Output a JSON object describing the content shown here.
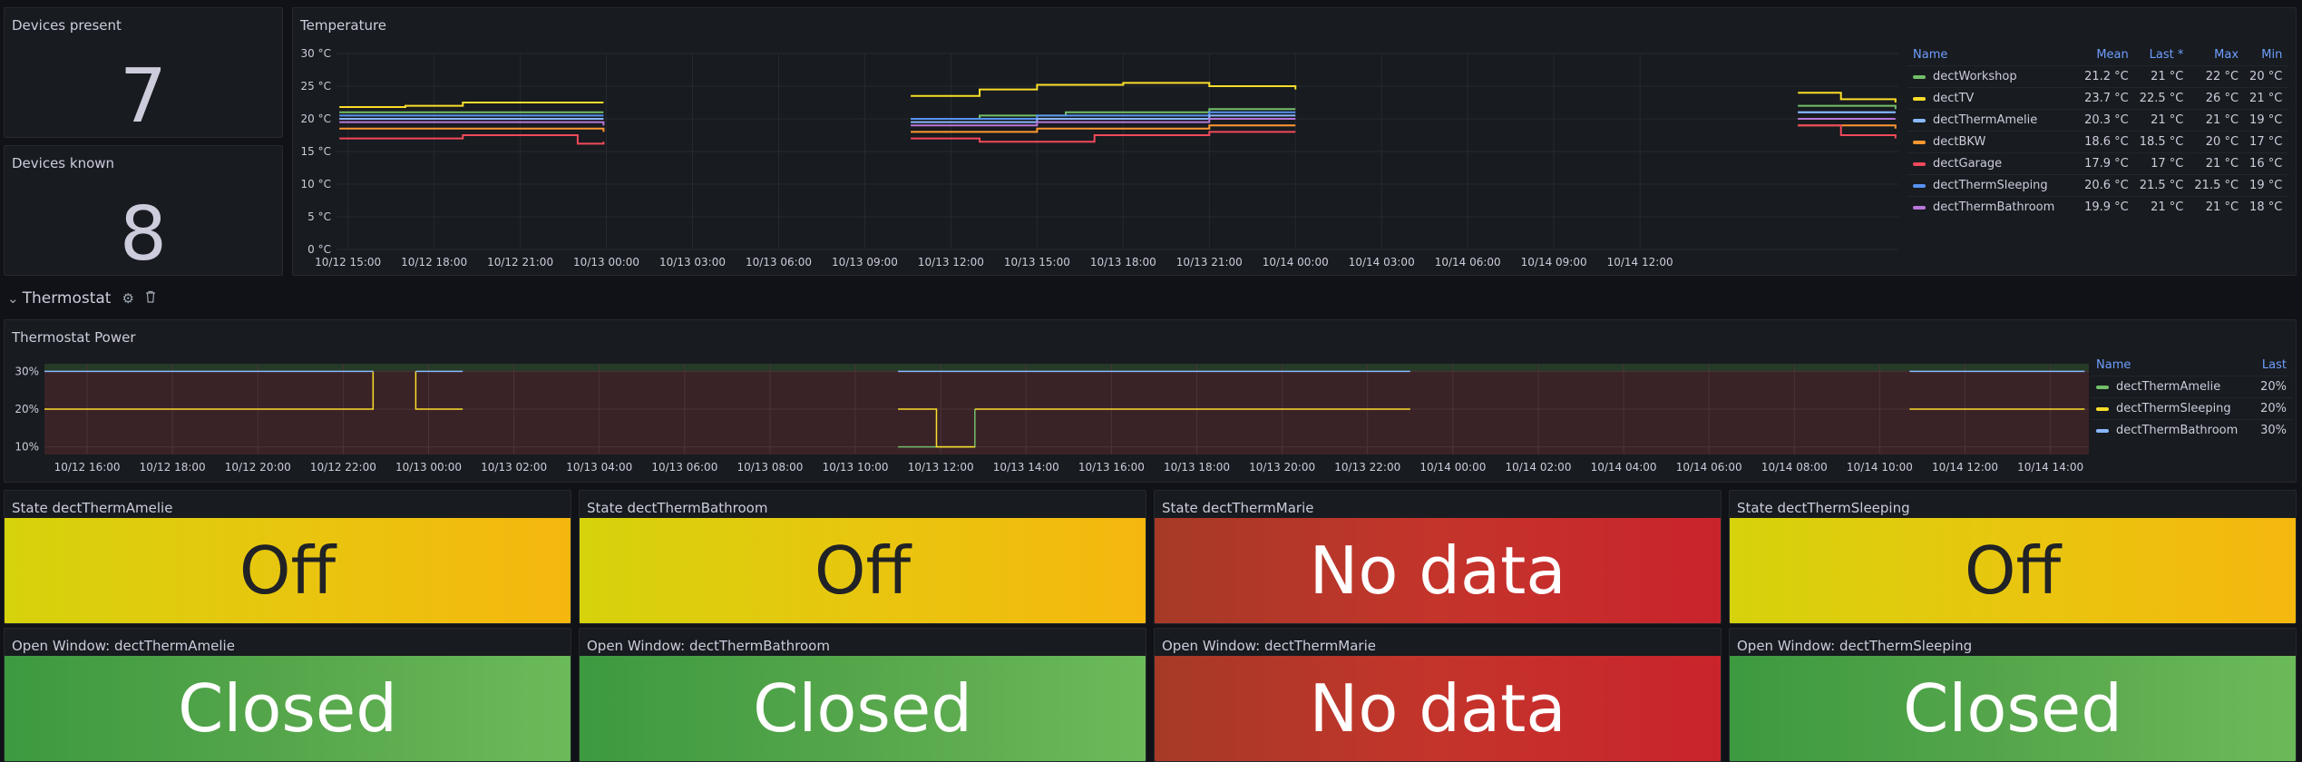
{
  "colors": {
    "workshop": "#73bf69",
    "tv": "#fade2a",
    "amelie": "#8ab8ff",
    "bkw": "#ff9830",
    "garage": "#f2495c",
    "sleeping": "#5794f2",
    "bathroom": "#b877d9",
    "yellow": "#e8c60f",
    "green": "#56a64b",
    "red": "#c4162a"
  },
  "devices_present": {
    "title": "Devices present",
    "value": "7"
  },
  "devices_known": {
    "title": "Devices known",
    "value": "8"
  },
  "temperature": {
    "title": "Temperature",
    "legend_headers": {
      "name": "Name",
      "mean": "Mean",
      "last": "Last *",
      "max": "Max",
      "min": "Min"
    },
    "legend": [
      {
        "name": "dectWorkshop",
        "mean": "21.2 °C",
        "last": "21 °C",
        "max": "22 °C",
        "min": "20 °C",
        "color": "#73bf69"
      },
      {
        "name": "dectTV",
        "mean": "23.7 °C",
        "last": "22.5 °C",
        "max": "26 °C",
        "min": "21 °C",
        "color": "#fade2a"
      },
      {
        "name": "dectThermAmelie",
        "mean": "20.3 °C",
        "last": "21 °C",
        "max": "21 °C",
        "min": "19 °C",
        "color": "#8ab8ff"
      },
      {
        "name": "dectBKW",
        "mean": "18.6 °C",
        "last": "18.5 °C",
        "max": "20 °C",
        "min": "17 °C",
        "color": "#ff9830"
      },
      {
        "name": "dectGarage",
        "mean": "17.9 °C",
        "last": "17 °C",
        "max": "21 °C",
        "min": "16 °C",
        "color": "#f2495c"
      },
      {
        "name": "dectThermSleeping",
        "mean": "20.6 °C",
        "last": "21.5 °C",
        "max": "21.5 °C",
        "min": "19 °C",
        "color": "#5794f2"
      },
      {
        "name": "dectThermBathroom",
        "mean": "19.9 °C",
        "last": "21 °C",
        "max": "21 °C",
        "min": "18 °C",
        "color": "#b877d9"
      }
    ]
  },
  "thermostat_row": {
    "title": "Thermostat",
    "settings_icon": "gear-icon",
    "delete_icon": "trash-icon",
    "collapse_icon": "chevron-down-icon"
  },
  "thermostat_power": {
    "title": "Thermostat Power",
    "legend_headers": {
      "name": "Name",
      "last": "Last"
    },
    "legend": [
      {
        "name": "dectThermAmelie",
        "last": "20%",
        "color": "#73bf69"
      },
      {
        "name": "dectThermSleeping",
        "last": "20%",
        "color": "#fade2a"
      },
      {
        "name": "dectThermBathroom",
        "last": "30%",
        "color": "#8ab8ff"
      }
    ]
  },
  "states": [
    {
      "title": "State dectThermAmelie",
      "value": "Off",
      "kind": "yellow"
    },
    {
      "title": "State dectThermBathroom",
      "value": "Off",
      "kind": "yellow"
    },
    {
      "title": "State dectThermMarie",
      "value": "No data",
      "kind": "red"
    },
    {
      "title": "State dectThermSleeping",
      "value": "Off",
      "kind": "yellow"
    }
  ],
  "windows": [
    {
      "title": "Open Window: dectThermAmelie",
      "value": "Closed",
      "kind": "green"
    },
    {
      "title": "Open Window: dectThermBathroom",
      "value": "Closed",
      "kind": "green"
    },
    {
      "title": "Open Window: dectThermMarie",
      "value": "No data",
      "kind": "red"
    },
    {
      "title": "Open Window: dectThermSleeping",
      "value": "Closed",
      "kind": "green"
    }
  ],
  "chart_data": [
    {
      "type": "line",
      "title": "Temperature",
      "x_ticks": [
        "10/12 15:00",
        "10/12 18:00",
        "10/12 21:00",
        "10/13 00:00",
        "10/13 03:00",
        "10/13 06:00",
        "10/13 09:00",
        "10/13 12:00",
        "10/13 15:00",
        "10/13 18:00",
        "10/13 21:00",
        "10/14 00:00",
        "10/14 03:00",
        "10/14 06:00",
        "10/14 09:00",
        "10/14 12:00"
      ],
      "x_range_hours": [
        -0.4,
        54.0
      ],
      "y_ticks": [
        "0 °C",
        "5 °C",
        "10 °C",
        "15 °C",
        "20 °C",
        "25 °C",
        "30 °C"
      ],
      "ylim": [
        0,
        30
      ],
      "series": [
        {
          "name": "dectTV",
          "segments": [
            [
              [
                -0.3,
                21.8
              ],
              [
                2,
                22
              ],
              [
                4,
                22.5
              ],
              [
                8,
                22.5
              ],
              [
                8.9,
                22.5
              ]
            ],
            [
              [
                19.6,
                23.5
              ],
              [
                22,
                24.5
              ],
              [
                24,
                25.2
              ],
              [
                27,
                25.5
              ],
              [
                30,
                25
              ],
              [
                33,
                24.5
              ]
            ],
            [
              [
                50.5,
                24
              ],
              [
                52,
                23
              ],
              [
                53.9,
                22.5
              ]
            ]
          ]
        },
        {
          "name": "dectWorkshop",
          "segments": [
            [
              [
                -0.3,
                21
              ],
              [
                4,
                21
              ],
              [
                8.9,
                21
              ]
            ],
            [
              [
                19.6,
                20
              ],
              [
                22,
                20.5
              ],
              [
                25,
                21
              ],
              [
                30,
                21.5
              ],
              [
                33,
                21.5
              ]
            ],
            [
              [
                50.5,
                22
              ],
              [
                53.9,
                21.5
              ]
            ]
          ]
        },
        {
          "name": "dectThermSleeping",
          "segments": [
            [
              [
                -0.3,
                20.5
              ],
              [
                4,
                20.5
              ],
              [
                8.9,
                20.5
              ]
            ],
            [
              [
                19.6,
                20
              ],
              [
                24,
                20.5
              ],
              [
                30,
                21
              ],
              [
                33,
                21
              ]
            ],
            [
              [
                50.5,
                21
              ],
              [
                53.9,
                21
              ]
            ]
          ]
        },
        {
          "name": "dectThermAmelie",
          "segments": [
            [
              [
                -0.3,
                20
              ],
              [
                4,
                20
              ],
              [
                8.9,
                20
              ]
            ],
            [
              [
                19.6,
                19.5
              ],
              [
                24,
                20
              ],
              [
                30,
                20.5
              ],
              [
                33,
                20.5
              ]
            ],
            [
              [
                50.5,
                21
              ],
              [
                53.9,
                21
              ]
            ]
          ]
        },
        {
          "name": "dectThermBathroom",
          "segments": [
            [
              [
                -0.3,
                19.5
              ],
              [
                4,
                19.5
              ],
              [
                8.9,
                19
              ]
            ],
            [
              [
                19.6,
                19
              ],
              [
                24,
                19.5
              ],
              [
                30,
                20
              ],
              [
                33,
                20
              ]
            ],
            [
              [
                50.5,
                20
              ],
              [
                53.9,
                20
              ]
            ]
          ]
        },
        {
          "name": "dectBKW",
          "segments": [
            [
              [
                -0.3,
                18.5
              ],
              [
                4,
                18.5
              ],
              [
                8.9,
                18
              ]
            ],
            [
              [
                19.6,
                18
              ],
              [
                24,
                18.5
              ],
              [
                30,
                19
              ],
              [
                33,
                19
              ]
            ],
            [
              [
                50.5,
                19
              ],
              [
                53.9,
                18.5
              ]
            ]
          ]
        },
        {
          "name": "dectGarage",
          "segments": [
            [
              [
                -0.3,
                17
              ],
              [
                4,
                17.5
              ],
              [
                7,
                17.5
              ],
              [
                8,
                16.2
              ],
              [
                8.9,
                16.5
              ]
            ],
            [
              [
                19.6,
                17
              ],
              [
                22,
                16.5
              ],
              [
                26,
                17.5
              ],
              [
                30,
                18
              ],
              [
                33,
                18
              ]
            ],
            [
              [
                50.5,
                19
              ],
              [
                52,
                17.5
              ],
              [
                53.9,
                17
              ]
            ]
          ]
        }
      ]
    },
    {
      "type": "line",
      "title": "Thermostat Power",
      "x_ticks": [
        "10/12 16:00",
        "10/12 18:00",
        "10/12 20:00",
        "10/12 22:00",
        "10/13 00:00",
        "10/13 02:00",
        "10/13 04:00",
        "10/13 06:00",
        "10/13 08:00",
        "10/13 10:00",
        "10/13 12:00",
        "10/13 14:00",
        "10/13 16:00",
        "10/13 18:00",
        "10/13 20:00",
        "10/13 22:00",
        "10/14 00:00",
        "10/14 02:00",
        "10/14 04:00",
        "10/14 06:00",
        "10/14 08:00",
        "10/14 10:00",
        "10/14 12:00",
        "10/14 14:00"
      ],
      "x_range_hours": [
        15.0,
        62.9
      ],
      "y_ticks": [
        "10%",
        "20%",
        "30%"
      ],
      "ylim": [
        8,
        32
      ],
      "thresholds": {
        "base_color": "red",
        "green_from": 30
      },
      "series": [
        {
          "name": "dectThermAmelie",
          "segments": [
            [
              [
                35.0,
                10
              ],
              [
                36.8,
                10
              ],
              [
                36.8,
                20
              ]
            ]
          ]
        },
        {
          "name": "dectThermSleeping",
          "segments": [
            [
              [
                15.0,
                20
              ],
              [
                22.7,
                20
              ],
              [
                22.7,
                30
              ]
            ],
            [
              [
                23.7,
                30
              ],
              [
                23.7,
                20
              ],
              [
                24.8,
                20
              ]
            ],
            [
              [
                35.0,
                20
              ],
              [
                35.9,
                20
              ],
              [
                35.9,
                10
              ],
              [
                36.8,
                10
              ]
            ],
            [
              [
                36.8,
                20
              ],
              [
                47.0,
                20
              ]
            ],
            [
              [
                58.7,
                20
              ],
              [
                62.8,
                20
              ]
            ]
          ]
        },
        {
          "name": "dectThermBathroom",
          "segments": [
            [
              [
                15.0,
                30
              ],
              [
                22.7,
                30
              ]
            ],
            [
              [
                23.7,
                30
              ],
              [
                24.8,
                30
              ]
            ],
            [
              [
                35.0,
                30
              ],
              [
                35.9,
                30
              ],
              [
                35.9,
                30
              ],
              [
                36.8,
                30
              ],
              [
                36.8,
                30
              ],
              [
                47.0,
                30
              ]
            ],
            [
              [
                58.7,
                30
              ],
              [
                62.8,
                30
              ]
            ]
          ]
        }
      ]
    }
  ]
}
